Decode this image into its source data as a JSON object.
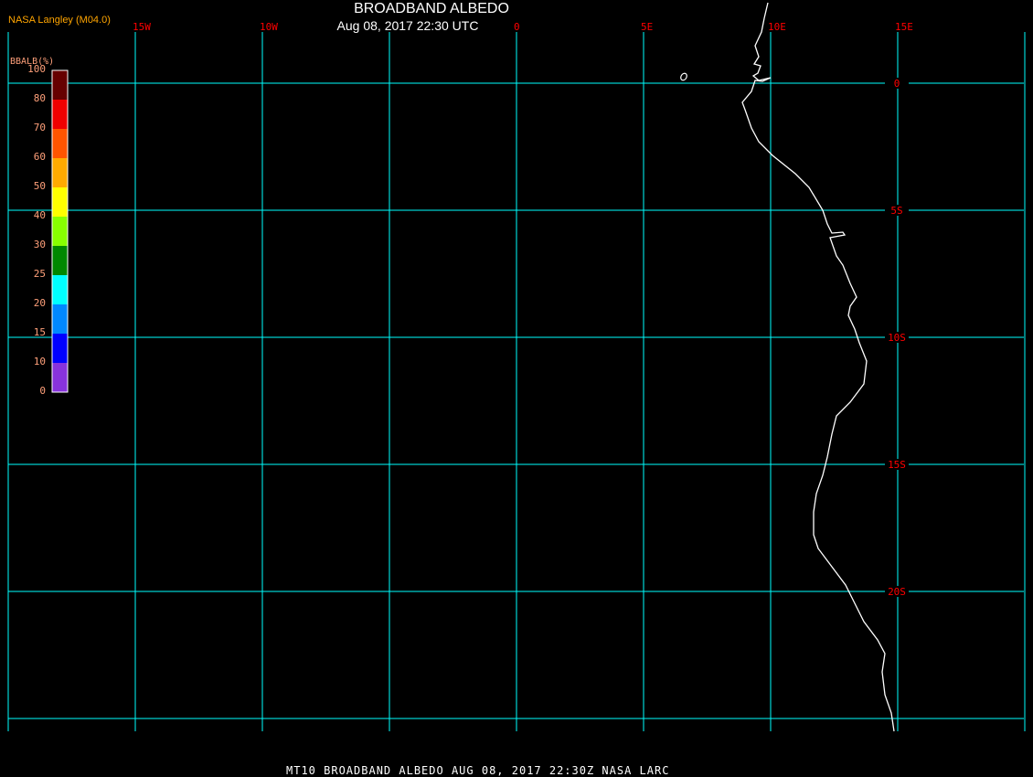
{
  "header": {
    "title": "BROADBAND ALBEDO",
    "subtitle": "Aug 08, 2017 22:30 UTC",
    "credit": "NASA Langley (M04.0)"
  },
  "footer": {
    "text": "MT10  BROADBAND ALBEDO   AUG 08, 2017 22:30Z   NASA LARC"
  },
  "map": {
    "grid_color": "#00ffff",
    "label_color": "#ff0000",
    "coastline_color": "#ffffff",
    "longitude_labels": [
      "15W",
      "10W",
      "0",
      "5E",
      "10E",
      "15E"
    ],
    "longitude_values": [
      -15,
      -10,
      0,
      5,
      10,
      15
    ],
    "latitude_labels": [
      "0",
      "5S",
      "10S",
      "15S",
      "20S"
    ],
    "latitude_values": [
      0,
      -5,
      -10,
      -15,
      -20
    ]
  },
  "legend": {
    "title": "BBALB(%)",
    "labels": [
      "100",
      "80",
      "70",
      "60",
      "50",
      "40",
      "30",
      "25",
      "20",
      "15",
      "10",
      "0"
    ],
    "colors": [
      "#660000",
      "#f00000",
      "#ff5500",
      "#ffaa00",
      "#ffff00",
      "#88ff00",
      "#008800",
      "#00ffff",
      "#0088ff",
      "#0000ff",
      "#8833dd"
    ]
  }
}
